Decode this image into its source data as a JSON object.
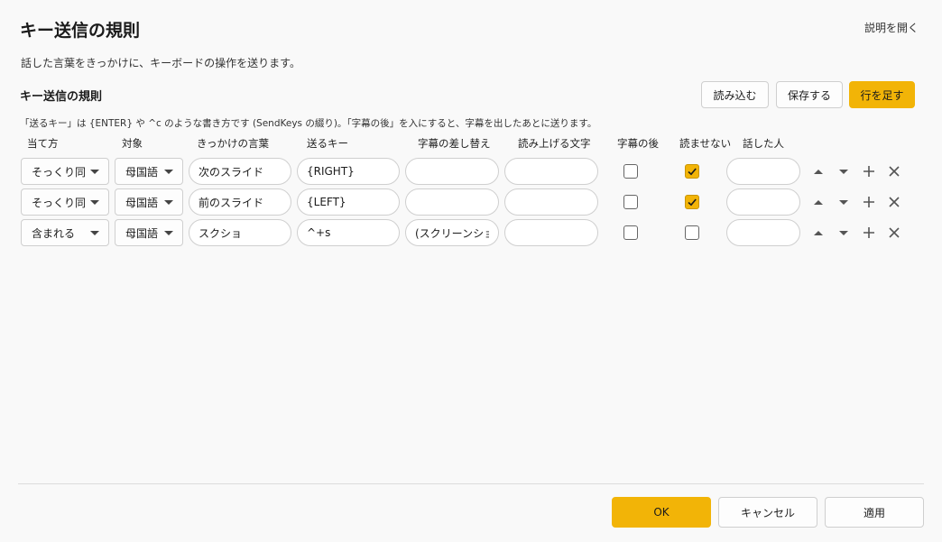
{
  "page": {
    "title": "キー送信の規則",
    "help_link": "説明を開く",
    "description": "話した言葉をきっかけに、キーボードの操作を送ります。"
  },
  "section": {
    "title": "キー送信の規則",
    "load_label": "読み込む",
    "save_label": "保存する",
    "add_row_label": "行を足す",
    "note": "「送るキー」は {ENTER} や ^c のような書き方です (SendKeys の綴り)。「字幕の後」を入にすると、字幕を出したあとに送ります。"
  },
  "columns": {
    "match": "当て方",
    "target": "対象",
    "trigger": "きっかけの言葉",
    "keys": "送るキー",
    "subtitle_replace": "字幕の差し替え",
    "readout": "読み上げる文字",
    "after_subtitle": "字幕の後",
    "mute": "読ませない",
    "speaker": "話した人"
  },
  "rows": [
    {
      "match": "そっくり同じ",
      "target": "母国語",
      "trigger": "次のスライド",
      "keys": "{RIGHT}",
      "subtitle_replace": "",
      "readout": "",
      "after_subtitle": false,
      "mute": true,
      "speaker": ""
    },
    {
      "match": "そっくり同じ",
      "target": "母国語",
      "trigger": "前のスライド",
      "keys": "{LEFT}",
      "subtitle_replace": "",
      "readout": "",
      "after_subtitle": false,
      "mute": true,
      "speaker": ""
    },
    {
      "match": "含まれる",
      "target": "母国語",
      "trigger": "スクショ",
      "keys": "^+s",
      "subtitle_replace": "(スクリーンショット)",
      "readout": "",
      "after_subtitle": false,
      "mute": false,
      "speaker": ""
    }
  ],
  "row_icons": [
    "caret-up-icon",
    "caret-down-icon",
    "plus-icon",
    "close-icon"
  ],
  "footer": {
    "ok_label": "OK",
    "cancel_label": "キャンセル",
    "apply_label": "適用"
  },
  "colors": {
    "accent": "#f2b407",
    "background": "#f9f9f9"
  }
}
